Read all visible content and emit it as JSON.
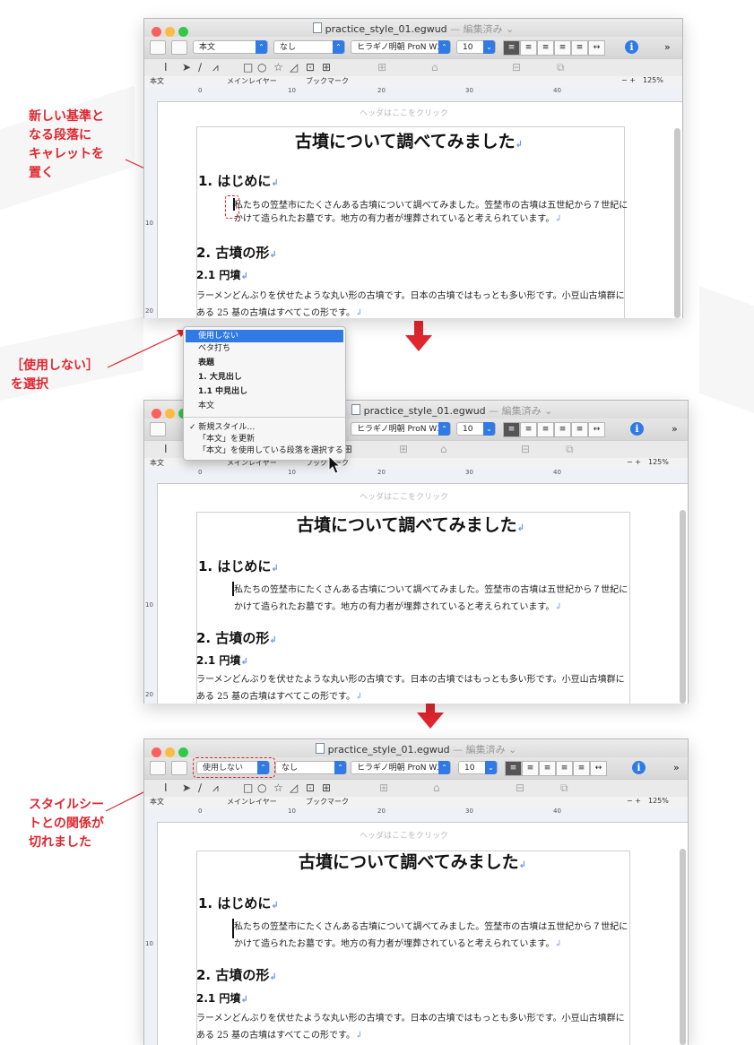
{
  "window": {
    "file_name": "practice_style_01.egwud",
    "status": "— 編集済み ⌄"
  },
  "toolbar": {
    "style_value_1": "本文",
    "style_value_3": "使用しない",
    "char_style": "なし",
    "font": "ヒラギノ明朝 ProN W3",
    "size": "10",
    "more": "»"
  },
  "ruler_bar": {
    "style": "本文",
    "layer": "メインレイヤー",
    "bookmark": "ブックマーク",
    "zoom": "125%",
    "zoom_controls": "− +"
  },
  "ruler_ticks": [
    "0",
    "10",
    "20",
    "30",
    "40"
  ],
  "left_ruler_ticks": [
    "10",
    "20"
  ],
  "document": {
    "header_hint": "ヘッダはここをクリック",
    "title": "古墳について調べてみました",
    "h1_1": "1. はじめに",
    "p1_line1": "私たちの笠埜市にたくさんある古墳について調べてみました。笠埜市の古墳は五世紀から７世紀に",
    "p1_line2": "かけて造られたお墓です。地方の有力者が埋葬されていると考えられています。",
    "h1_2": "2. 古墳の形",
    "h2_1": "2.1 円墳",
    "p2_line1": "ラーメンどんぶりを伏せたような丸い形の古墳です。日本の古墳ではもっとも多い形です。小豆山古墳群に",
    "p2_line2": "ある 25 基の古墳はすべてこの形です。",
    "return_mark": "↲"
  },
  "callouts": {
    "c1": "新しい基準と\nなる段落に\nキャレットを\n置く",
    "c2": "［使用しない］\nを選択",
    "c3": "スタイルシー\nトとの関係が\n切れました"
  },
  "menu": {
    "items": [
      "使用しない",
      "ベタ打ち",
      "表題",
      "1. 大見出し",
      "1.1 中見出し",
      "本文"
    ],
    "sub_items": [
      "✓ 新規スタイル…",
      "「本文」を更新",
      "「本文」を使用している段落を選択する"
    ]
  },
  "colors": {
    "accent": "#e0262f",
    "select_blue": "#2f7ae5"
  }
}
